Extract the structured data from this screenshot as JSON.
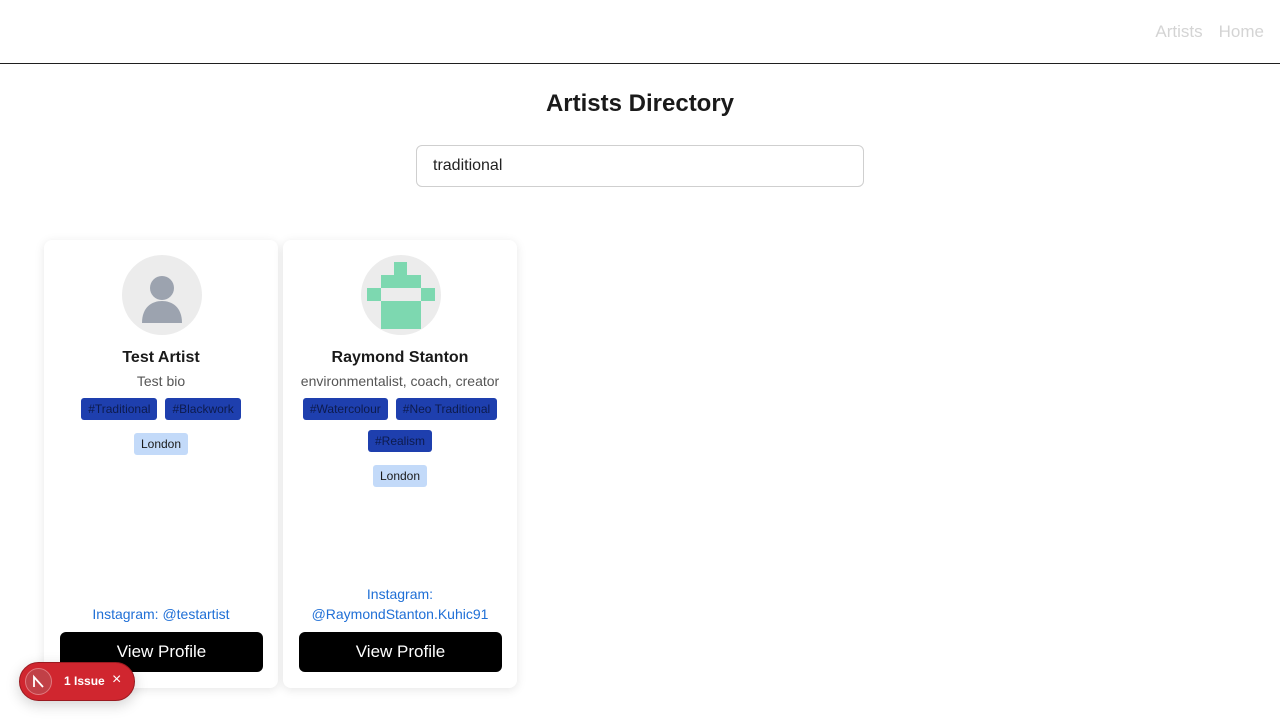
{
  "nav": {
    "artists": "Artists",
    "home": "Home"
  },
  "page": {
    "title": "Artists Directory"
  },
  "search": {
    "value": "traditional"
  },
  "artists": [
    {
      "name": "Test Artist",
      "bio": "Test bio",
      "tags": [
        "#Traditional",
        "#Blackwork"
      ],
      "location": "London",
      "instagram": "Instagram: @testartist",
      "avatar": "default-person-icon",
      "button": "View Profile"
    },
    {
      "name": "Raymond Stanton",
      "bio": "environmentalist, coach, creator",
      "tags": [
        "#Watercolour",
        "#Neo Traditional",
        "#Realism"
      ],
      "location": "London",
      "instagram_line1": "Instagram:",
      "instagram_line2": "@RaymondStanton.Kuhic91",
      "avatar": "identicon-avatar",
      "button": "View Profile"
    }
  ],
  "issue_badge": {
    "label": "1 Issue",
    "color": "#d0262f"
  },
  "colors": {
    "tag": "#1e3fae",
    "location": "#c3daf9",
    "link": "#1f6fd6",
    "button": "#000000"
  }
}
